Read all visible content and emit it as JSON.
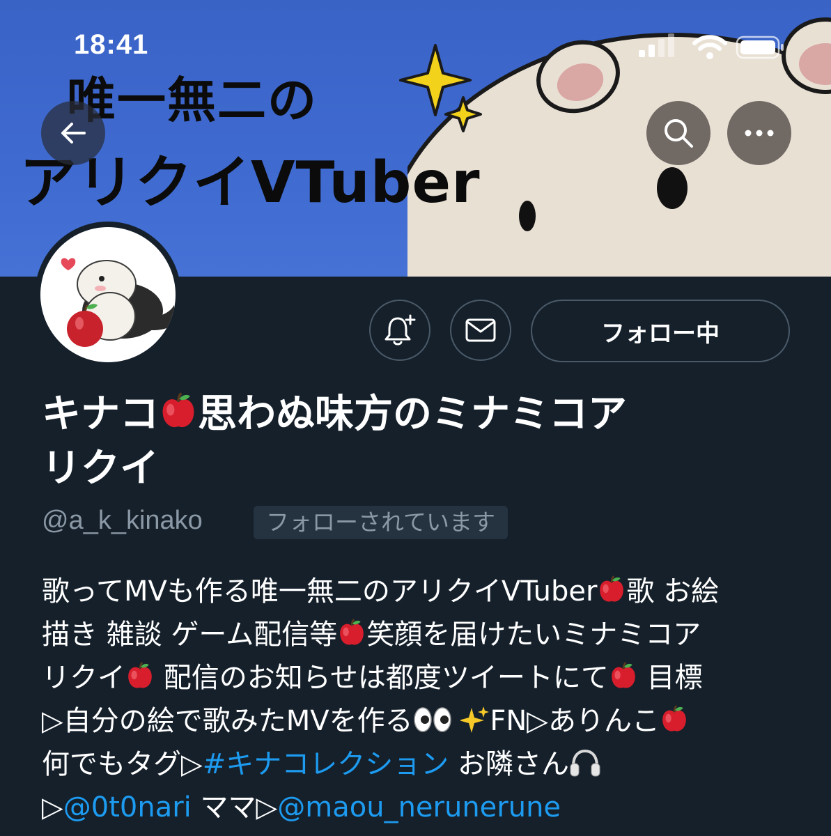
{
  "status_bar": {
    "time": "18:41"
  },
  "banner": {
    "line1": "唯一無二の",
    "line2": "アリクイVTuber"
  },
  "header": {
    "back_icon": "arrow-left-icon",
    "search_icon": "search-icon",
    "more_icon": "more-dots-icon"
  },
  "actions": {
    "notify_icon": "bell-plus-icon",
    "message_icon": "envelope-icon",
    "follow_label": "フォロー中"
  },
  "profile": {
    "name_part1": "キナコ",
    "name_part2": "思わぬ味方のミナミコア",
    "name_part3": "リクイ",
    "handle": "@a_k_kinako",
    "follows_you": "フォローされています"
  },
  "bio": {
    "l1a": "歌ってMVも作る唯一無二のアリクイVTuber",
    "l1b": "歌 お絵",
    "l2a": "描き 雑談 ゲーム配信等",
    "l2b": "笑顔を届けたいミナミコア",
    "l3a": "リクイ",
    "l3b": " 配信のお知らせは都度ツイートにて",
    "l3c": " 目標",
    "l4a": "▷自分の絵で歌みたMVを作る",
    "l4b": "FN▷ありんこ",
    "l5a": "何でもタグ▷",
    "l5_hashtag": "#キナコレクション",
    "l5b": " お隣さん",
    "l6a": "▷",
    "l6_mention1": "@0t0nari",
    "l6b": " ママ▷",
    "l6_mention2": "@maou_nerunerune"
  },
  "colors": {
    "background": "#15202b",
    "link": "#1d9bf0",
    "muted": "#8b98a5",
    "banner_blue": "#3f6ad0"
  }
}
